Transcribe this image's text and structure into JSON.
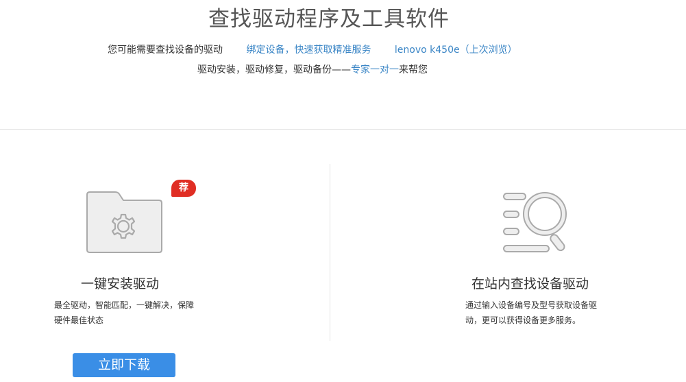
{
  "header": {
    "title": "查找驱动程序及工具软件",
    "subtitle_prefix": "您可能需要查找设备的驱动",
    "bind_device_link": "绑定设备，快速获取精准服务",
    "recent_device_link": "lenovo k450e（上次浏览）",
    "line2_prefix": "驱动安装，驱动修复，驱动备份——",
    "expert_link": "专家一对一",
    "line2_suffix": "来帮您"
  },
  "left_card": {
    "badge": "荐",
    "title": "一键安装驱动",
    "description": "最全驱动，智能匹配，一键解决，保障硬件最佳状态",
    "button_label": "立即下载",
    "icon": "folder-gear-icon"
  },
  "right_card": {
    "title": "在站内查找设备驱动",
    "description": "通过输入设备编号及型号获取设备驱动，更可以获得设备更多服务。",
    "icon": "search-list-icon"
  },
  "colors": {
    "link": "#3b86c6",
    "badge": "#e02e24",
    "button": "#3a8ee6"
  }
}
